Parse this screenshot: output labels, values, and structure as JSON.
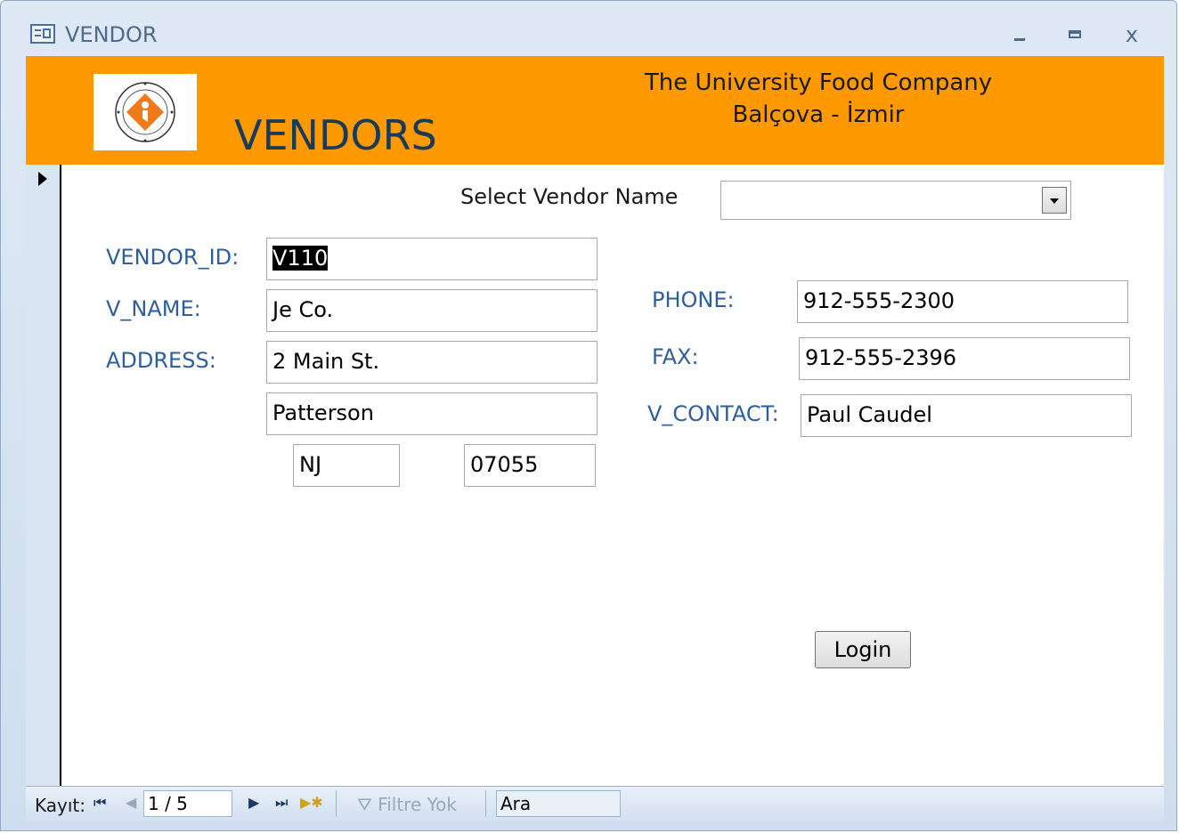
{
  "window": {
    "title": "VENDOR",
    "controls": {
      "minimize": "minimize",
      "maximize": "maximize",
      "close": "x"
    }
  },
  "header": {
    "title": "VENDORS",
    "company_line1": "The University Food Company",
    "company_line2": "Balçova - İzmir",
    "logo_icon": "izmir-ekonomi-universitesi-logo",
    "background": "#ff9900"
  },
  "form": {
    "select_vendor_label": "Select Vendor Name",
    "select_vendor_value": "",
    "vendor_id_label": "VENDOR_ID:",
    "vendor_id_value": "V110",
    "v_name_label": "V_NAME:",
    "v_name_value": "Je Co.",
    "address_label": "ADDRESS:",
    "address_value": "2 Main St.",
    "city_value": "Patterson",
    "state_value": "NJ",
    "zip_value": "07055",
    "phone_label": "PHONE:",
    "phone_value": "912-555-2300",
    "fax_label": "FAX:",
    "fax_value": "912-555-2396",
    "contact_label": "V_CONTACT:",
    "contact_value": "Paul Caudel",
    "login_label": "Login",
    "label_color": "#2e5e9e"
  },
  "navigation": {
    "record_label": "Kayıt:",
    "first_icon": "first-record-icon",
    "prev_icon": "previous-record-icon",
    "position": "1 / 5",
    "next_icon": "next-record-icon",
    "last_icon": "last-record-icon",
    "new_icon": "new-record-icon",
    "filter_label": "Filtre Yok",
    "search_label": "Ara"
  }
}
